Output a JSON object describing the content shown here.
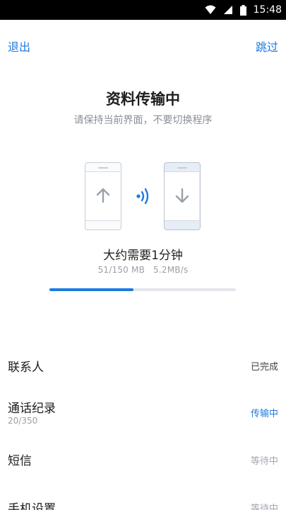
{
  "status_bar": {
    "time": "15:48",
    "icons": [
      "wifi-icon",
      "signal-icon",
      "battery-icon"
    ]
  },
  "header": {
    "exit_label": "退出",
    "skip_label": "跳过"
  },
  "title": "资料传输中",
  "subtitle": "请保持当前界面，不要切换程序",
  "transfer": {
    "eta": "大约需要1分钟",
    "transferred": "51/150 MB",
    "speed": "5.2MB/s",
    "progress_percent": 45
  },
  "items": [
    {
      "name": "联系人",
      "count": "",
      "status": "已完成",
      "state": "done"
    },
    {
      "name": "通话纪录",
      "count": "20/350",
      "status": "传输中",
      "state": "active"
    },
    {
      "name": "短信",
      "count": "",
      "status": "等待中",
      "state": "wait"
    },
    {
      "name": "手机设置",
      "count": "",
      "status": "等待中",
      "state": "wait"
    }
  ],
  "colors": {
    "accent": "#1e7be0",
    "muted": "#9aa0a8",
    "track": "#e3e6ea"
  }
}
